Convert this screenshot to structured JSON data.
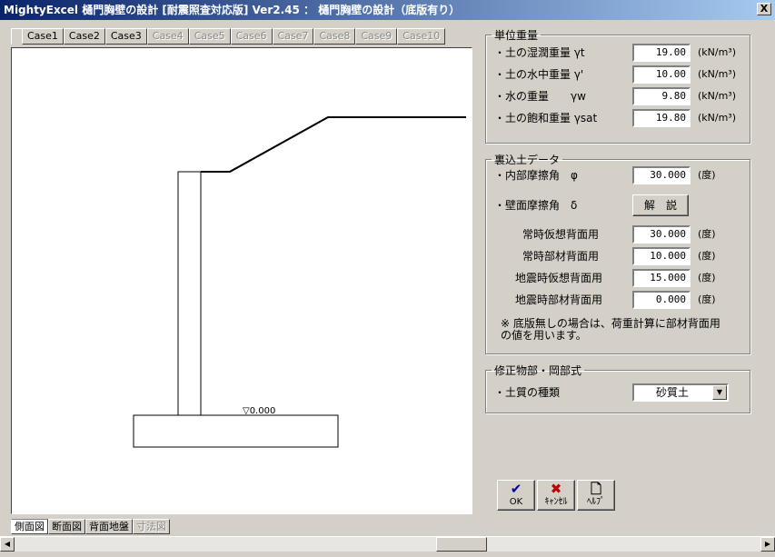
{
  "window": {
    "title": "MightyExcel 樋門胸壁の設計 [耐震照査対応版] Ver2.45 ： 樋門胸壁の設計（底版有り）",
    "close_label": "X"
  },
  "case_tabs": [
    {
      "label": "Case1",
      "enabled": true
    },
    {
      "label": "Case2",
      "enabled": true
    },
    {
      "label": "Case3",
      "enabled": true
    },
    {
      "label": "Case4",
      "enabled": false
    },
    {
      "label": "Case5",
      "enabled": false
    },
    {
      "label": "Case6",
      "enabled": false
    },
    {
      "label": "Case7",
      "enabled": false
    },
    {
      "label": "Case8",
      "enabled": false
    },
    {
      "label": "Case9",
      "enabled": false
    },
    {
      "label": "Case10",
      "enabled": false
    }
  ],
  "drawing": {
    "elevation_label": "▽0.000"
  },
  "view_tabs": [
    {
      "label": "側面図",
      "active": true,
      "enabled": true
    },
    {
      "label": "断面図",
      "active": false,
      "enabled": true
    },
    {
      "label": "背面地盤",
      "active": false,
      "enabled": true
    },
    {
      "label": "寸法図",
      "active": false,
      "enabled": false
    }
  ],
  "unit_weight": {
    "legend": "単位重量",
    "rows": [
      {
        "label": "・土の湿潤重量 γt",
        "value": "19.00",
        "unit": "(kN/m³)"
      },
      {
        "label": "・土の水中重量 γ'",
        "value": "10.00",
        "unit": "(kN/m³)"
      },
      {
        "label": "・水の重量　　γw",
        "value": "9.80",
        "unit": "(kN/m³)"
      },
      {
        "label": "・土の飽和重量 γsat",
        "value": "19.80",
        "unit": "(kN/m³)"
      }
    ]
  },
  "backfill": {
    "legend": "裏込土データ",
    "friction_label": "・内部摩擦角　φ",
    "friction_value": "30.000",
    "friction_unit": "(度)",
    "wall_friction_label": "・壁面摩擦角　δ",
    "explain_button": "解　説",
    "rows": [
      {
        "label": "常時仮想背面用",
        "value": "30.000",
        "unit": "(度)"
      },
      {
        "label": "常時部材背面用",
        "value": "10.000",
        "unit": "(度)"
      },
      {
        "label": "地震時仮想背面用",
        "value": "15.000",
        "unit": "(度)"
      },
      {
        "label": "地震時部材背面用",
        "value": "0.000",
        "unit": "(度)"
      }
    ],
    "note_line1": "※ 底版無しの場合は、荷重計算に部材背面用",
    "note_line2": "の値を用います。"
  },
  "modified": {
    "legend": "修正物部・岡部式",
    "soil_label": "・土質の種類",
    "soil_value": "砂質土"
  },
  "buttons": {
    "ok": "OK",
    "cancel": "ｷｬﾝｾﾙ",
    "help": "ﾍﾙﾌﾟ"
  },
  "colors": {
    "title_start": "#0a246a",
    "title_end": "#a6caf0",
    "ok_icon": "#0000a0",
    "cancel_icon": "#c00000"
  },
  "icons": {
    "ok": "checkmark-icon",
    "cancel": "x-icon",
    "help": "document-icon"
  }
}
